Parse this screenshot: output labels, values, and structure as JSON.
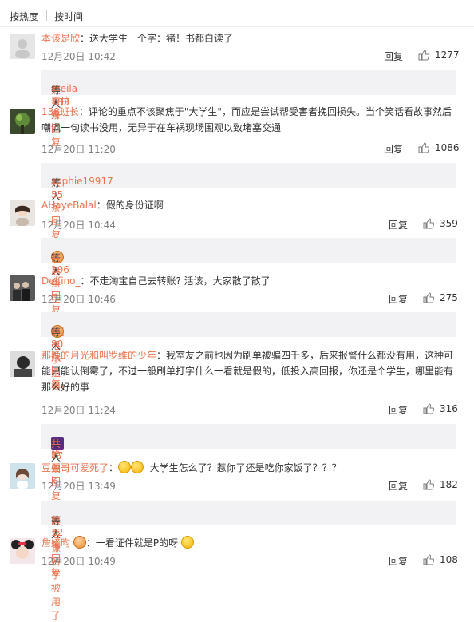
{
  "sort": {
    "hot": "按热度",
    "time": "按时间"
  },
  "reply_label": "回复",
  "comments": [
    {
      "name": "本该是欣",
      "text": "：送大学生一个字：猪！书都白读了",
      "time": "12月20日 10:42",
      "likes": "1277",
      "summary": {
        "name": "meila麦拉卉",
        "middle": " 等人 ",
        "count": "共183条回复"
      }
    },
    {
      "name": "138班长",
      "text": "：评论的重点不该聚焦于\"大学生\"，而应是尝试帮受害者挽回损失。当个笑话看故事然后嘲讽一句读书没用，无异于在车祸现场围观以致堵塞交通",
      "time": "12月20日 11:20",
      "likes": "1086",
      "summary": {
        "name": "sophie19917",
        "middle": " 等人 ",
        "count": "共55条回复"
      }
    },
    {
      "name": "AHayeBalal",
      "text": "：假的身份证啊",
      "time": "12月20日 10:44",
      "likes": "359",
      "summary": {
        "name": "而后一生",
        "middle": " 等人 ",
        "count": "共106条回复"
      }
    },
    {
      "name": "Delfino_",
      "text": "：不走淘宝自己去转账? 活该，大家散了散了",
      "time": "12月20日 10:46",
      "likes": "275",
      "summary": {
        "name": "-腿毛小姐姐-",
        "middle": " 等人 ",
        "count": "共80条回复"
      }
    },
    {
      "name": "那晚的月光和叫罗维的少年",
      "text": "：我室友之前也因为刷单被骗四千多，后来报警什么都没有用，这种可能只能认倒霉了，不过一般刷单打字什么一看就是假的，低投入高回报，你还是个学生，哪里能有那么好的事",
      "time": "12月20日 11:24",
      "likes": "316",
      "summary": {
        "name": "m晚归k",
        "middle": " 等人 ",
        "count": "共77条回复"
      }
    },
    {
      "name": "豆豆哥可爱死了",
      "text": "大学生怎么了？惹你了还是吃你家饭了？？？",
      "time": "12月20日 13:49",
      "likes": "182",
      "summary": {
        "name": "薛之谦名字被用了",
        "middle": " 等人 ",
        "count": "共12条回复"
      }
    },
    {
      "name": "詹嫡昀",
      "text": "：一看证件就是P的呀",
      "time": "12月20日 10:49",
      "likes": "108"
    }
  ],
  "colors": {
    "accent": "#eb7350",
    "muted": "#808080",
    "summary_bg": "#f2f2f5"
  }
}
